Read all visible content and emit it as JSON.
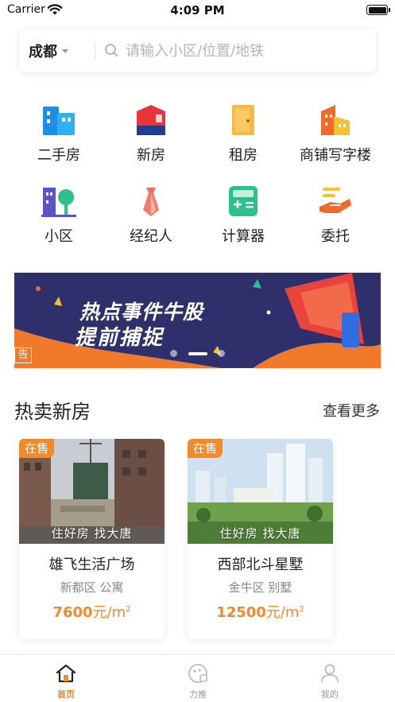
{
  "status_bar": {
    "carrier": "Carrier",
    "time": "4:09 PM"
  },
  "search": {
    "city": "成都",
    "placeholder": "请输入小区/位置/地铁"
  },
  "categories": [
    {
      "label": "二手房",
      "icon": "second-hand-house-icon"
    },
    {
      "label": "新房",
      "icon": "new-house-icon"
    },
    {
      "label": "租房",
      "icon": "rent-door-icon"
    },
    {
      "label": "商铺写字楼",
      "icon": "office-building-icon"
    },
    {
      "label": "小区",
      "icon": "community-icon"
    },
    {
      "label": "经纪人",
      "icon": "agent-tie-icon"
    },
    {
      "label": "计算器",
      "icon": "calculator-icon"
    },
    {
      "label": "委托",
      "icon": "entrust-hand-icon"
    }
  ],
  "banner": {
    "title_line1": "热点事件牛股",
    "title_line2": "提前捕捉",
    "edge_text": "告",
    "slides": 3,
    "active_slide": 1
  },
  "section": {
    "title": "热卖新房",
    "more": "查看更多"
  },
  "listings": [
    {
      "badge": "在售",
      "caption": "住好房 找大唐",
      "name": "雄飞生活广场",
      "district": "新都区",
      "type": "公寓",
      "price": "7600",
      "unit": "元/m",
      "unit_sup": "2"
    },
    {
      "badge": "在售",
      "caption": "住好房 找大唐",
      "name": "西部北斗星墅",
      "district": "金牛区",
      "type": "别墅",
      "price": "12500",
      "unit": "元/m",
      "unit_sup": "2"
    }
  ],
  "tabs": [
    {
      "label": "首页",
      "icon": "home-icon",
      "active": true
    },
    {
      "label": "力推",
      "icon": "recommend-icon",
      "active": false
    },
    {
      "label": "我的",
      "icon": "profile-icon",
      "active": false
    }
  ],
  "colors": {
    "accent": "#f08a2b",
    "banner_bg": "#2e2f6b"
  }
}
